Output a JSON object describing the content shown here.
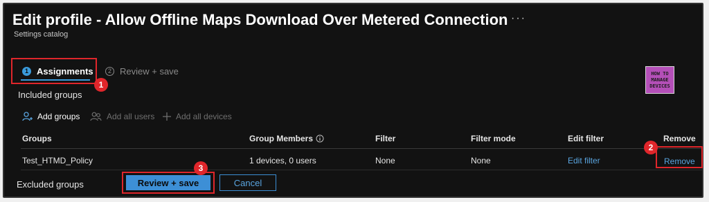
{
  "header": {
    "title": "Edit profile - Allow Offline Maps Download Over Metered Connection",
    "more_label": "···",
    "subtitle": "Settings catalog"
  },
  "tabs": [
    {
      "number": "1",
      "label": "Assignments",
      "active": true
    },
    {
      "number": "2",
      "label": "Review + save",
      "active": false
    }
  ],
  "annotations": [
    "1",
    "2",
    "3"
  ],
  "logo": {
    "lines": [
      "HOW TO",
      "MANAGE",
      "DEVICES"
    ]
  },
  "included": {
    "label": "Included groups",
    "toolbar": {
      "add_groups": "Add groups",
      "add_all_users": "Add all users",
      "add_all_devices": "Add all devices"
    },
    "columns": [
      "Groups",
      "Group Members",
      "Filter",
      "Filter mode",
      "Edit filter",
      "Remove"
    ],
    "rows": [
      {
        "group": "Test_HTMD_Policy",
        "members": "1 devices, 0 users",
        "filter": "None",
        "filter_mode": "None",
        "edit_filter": "Edit filter",
        "remove": "Remove"
      }
    ]
  },
  "excluded": {
    "label": "Excluded groups"
  },
  "footer": {
    "primary_label": "Review + save",
    "secondary_label": "Cancel"
  },
  "colors": {
    "accent": "#3d8fd6",
    "annotation_red": "#e0262b",
    "background": "#121212"
  }
}
